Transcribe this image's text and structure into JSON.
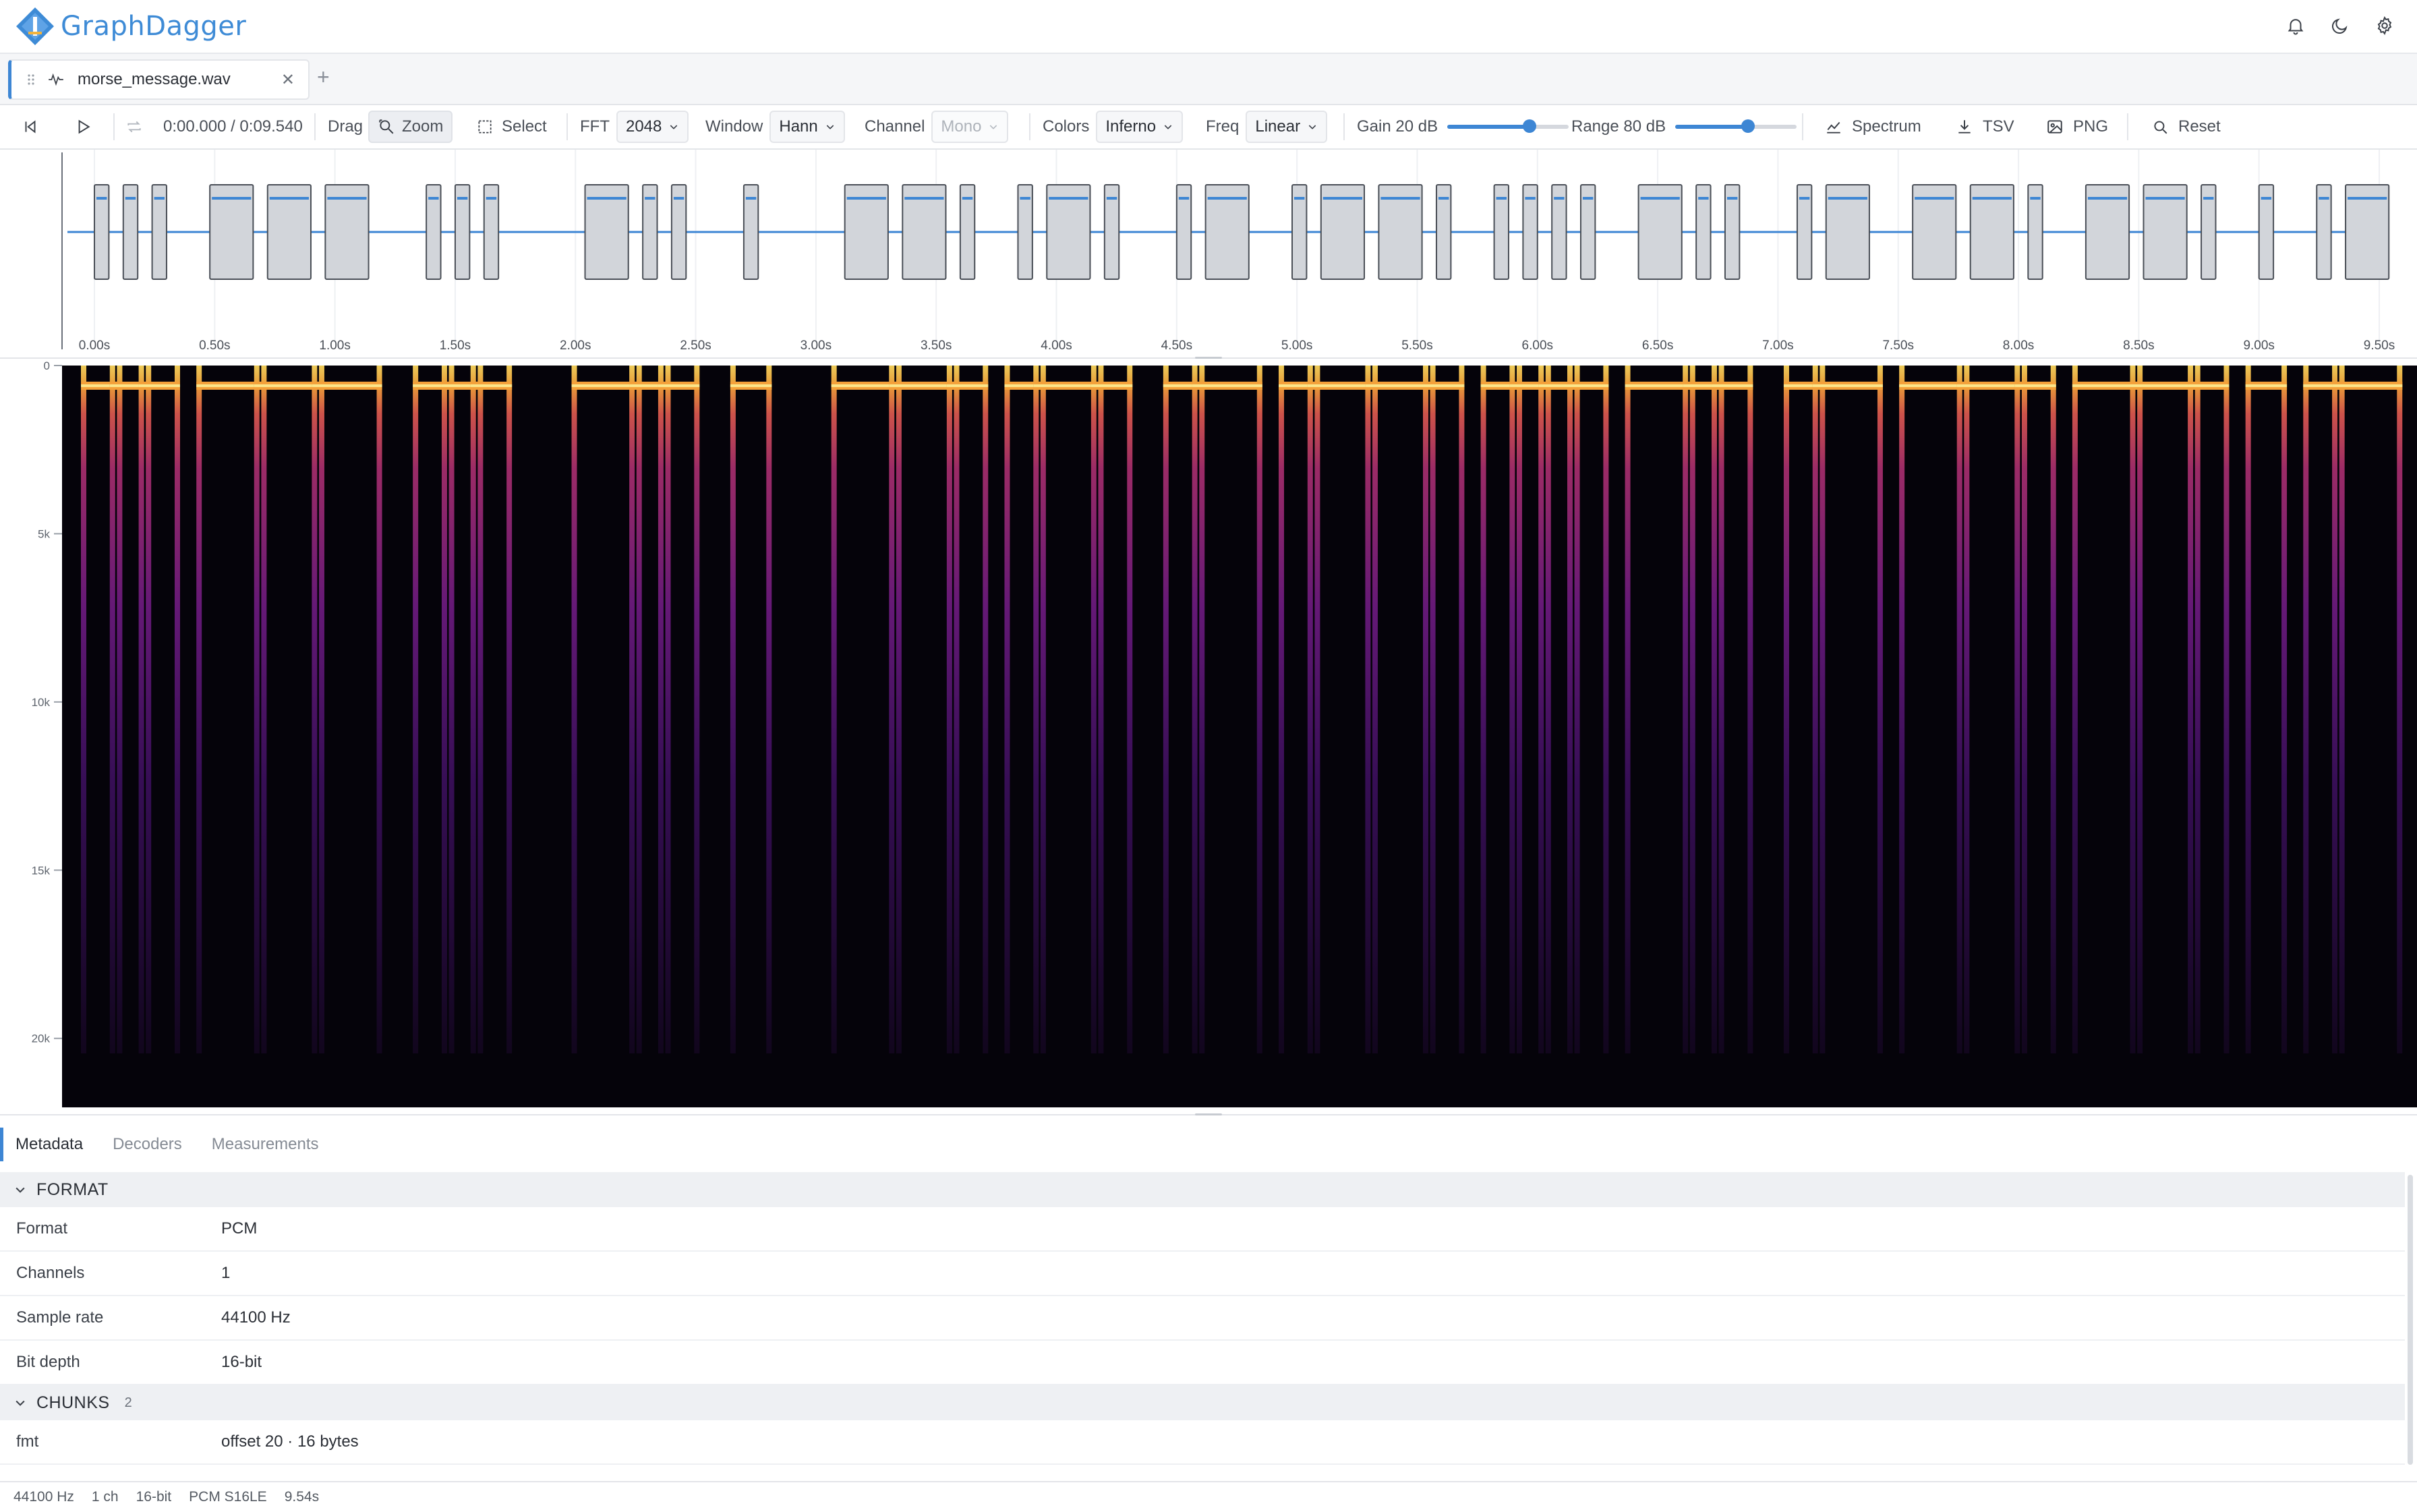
{
  "app": {
    "name": "GraphDagger",
    "brand_color": "#3e8bd6",
    "accent_color": "#3d86d4"
  },
  "header_icons": [
    "bell-icon",
    "moon-icon",
    "gear-icon"
  ],
  "tabs": [
    {
      "label": "morse_message.wav",
      "active": true
    }
  ],
  "toolbar": {
    "time": "0:00.000 / 0:09.540",
    "drag_label": "Drag",
    "zoom_label": "Zoom",
    "select_label": "Select",
    "fft_label": "FFT",
    "fft_value": "2048",
    "window_label": "Window",
    "window_value": "Hann",
    "channel_label": "Channel",
    "channel_value": "Mono",
    "colors_label": "Colors",
    "colors_value": "Inferno",
    "freq_label": "Freq",
    "freq_value": "Linear",
    "gain_label": "Gain 20 dB",
    "gain_fraction": 0.68,
    "range_label": "Range 80 dB",
    "range_fraction": 0.6,
    "spectrum_label": "Spectrum",
    "tsv_label": "TSV",
    "png_label": "PNG",
    "reset_label": "Reset"
  },
  "waveform": {
    "time_ticks": [
      "0.00s",
      "0.50s",
      "1.00s",
      "1.50s",
      "2.00s",
      "2.50s",
      "3.00s",
      "3.50s",
      "4.00s",
      "4.50s",
      "5.00s",
      "5.50s",
      "6.00s",
      "6.50s",
      "7.00s",
      "7.50s",
      "8.00s",
      "8.50s",
      "9.00s",
      "9.50s"
    ],
    "tick_values": [
      0,
      0.5,
      1,
      1.5,
      2,
      2.5,
      3,
      3.5,
      4,
      4.5,
      5,
      5.5,
      6,
      6.5,
      7,
      7.5,
      8,
      8.5,
      9,
      9.5
    ],
    "duration": 9.54,
    "bursts": [
      [
        0.0,
        0.06
      ],
      [
        0.12,
        0.18
      ],
      [
        0.24,
        0.3
      ],
      [
        0.48,
        0.66
      ],
      [
        0.72,
        0.9
      ],
      [
        0.96,
        1.14
      ],
      [
        1.38,
        1.44
      ],
      [
        1.5,
        1.56
      ],
      [
        1.62,
        1.68
      ],
      [
        2.04,
        2.22
      ],
      [
        2.28,
        2.34
      ],
      [
        2.4,
        2.46
      ],
      [
        2.7,
        2.76
      ],
      [
        3.12,
        3.3
      ],
      [
        3.36,
        3.54
      ],
      [
        3.6,
        3.66
      ],
      [
        3.84,
        3.9
      ],
      [
        3.96,
        4.14
      ],
      [
        4.2,
        4.26
      ],
      [
        4.5,
        4.56
      ],
      [
        4.62,
        4.8
      ],
      [
        4.98,
        5.04
      ],
      [
        5.1,
        5.28
      ],
      [
        5.34,
        5.52
      ],
      [
        5.58,
        5.64
      ],
      [
        5.82,
        5.88
      ],
      [
        5.94,
        6.0
      ],
      [
        6.06,
        6.12
      ],
      [
        6.18,
        6.24
      ],
      [
        6.42,
        6.6
      ],
      [
        6.66,
        6.72
      ],
      [
        6.78,
        6.84
      ],
      [
        7.08,
        7.14
      ],
      [
        7.2,
        7.38
      ],
      [
        7.56,
        7.74
      ],
      [
        7.8,
        7.98
      ],
      [
        8.04,
        8.1
      ],
      [
        8.28,
        8.46
      ],
      [
        8.52,
        8.7
      ],
      [
        8.76,
        8.82
      ],
      [
        9.0,
        9.06
      ],
      [
        9.24,
        9.3
      ],
      [
        9.36,
        9.54
      ]
    ]
  },
  "spectrogram": {
    "y_ticks": [
      "0",
      "5k",
      "10k",
      "15k",
      "20k"
    ],
    "y_values": [
      0,
      5000,
      10000,
      15000,
      20000
    ],
    "max_freq": 22050,
    "tone_freq": 600,
    "colormap": "inferno"
  },
  "panel": {
    "tabs": [
      "Metadata",
      "Decoders",
      "Measurements"
    ],
    "format_section": "FORMAT",
    "format_rows": [
      {
        "key": "Format",
        "value": "PCM"
      },
      {
        "key": "Channels",
        "value": "1"
      },
      {
        "key": "Sample rate",
        "value": "44100 Hz"
      },
      {
        "key": "Bit depth",
        "value": "16-bit"
      }
    ],
    "chunks_section": "CHUNKS",
    "chunks_count": "2",
    "chunk_rows": [
      {
        "key": "fmt",
        "value": "offset 20 · 16 bytes"
      }
    ]
  },
  "status": [
    "44100 Hz",
    "1 ch",
    "16-bit",
    "PCM S16LE",
    "9.54s"
  ]
}
